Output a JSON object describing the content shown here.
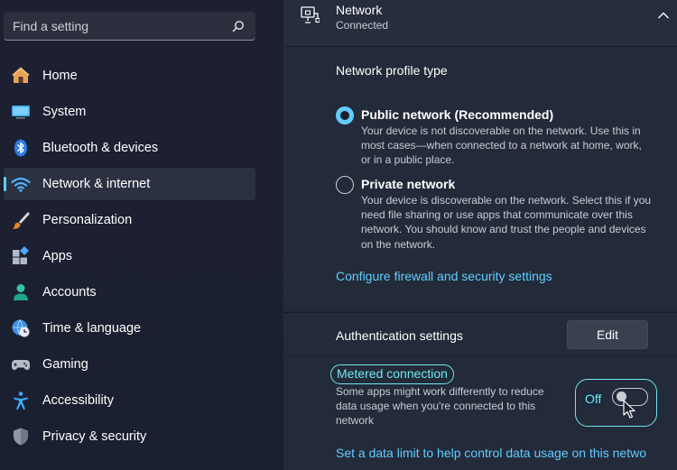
{
  "search": {
    "placeholder": "Find a setting"
  },
  "sidebar": {
    "items": [
      {
        "label": "Home",
        "icon": "home-icon",
        "active": false
      },
      {
        "label": "System",
        "icon": "monitor-icon",
        "active": false
      },
      {
        "label": "Bluetooth & devices",
        "icon": "bluetooth-icon",
        "active": false
      },
      {
        "label": "Network & internet",
        "icon": "wifi-icon",
        "active": true
      },
      {
        "label": "Personalization",
        "icon": "brush-icon",
        "active": false
      },
      {
        "label": "Apps",
        "icon": "apps-icon",
        "active": false
      },
      {
        "label": "Accounts",
        "icon": "person-icon",
        "active": false
      },
      {
        "label": "Time & language",
        "icon": "globe-clock-icon",
        "active": false
      },
      {
        "label": "Gaming",
        "icon": "gamepad-icon",
        "active": false
      },
      {
        "label": "Accessibility",
        "icon": "accessibility-icon",
        "active": false
      },
      {
        "label": "Privacy & security",
        "icon": "shield-icon",
        "active": false
      }
    ]
  },
  "header": {
    "title": "Network",
    "subtitle": "Connected"
  },
  "profile": {
    "title": "Network profile type",
    "options": [
      {
        "label": "Public network (Recommended)",
        "description": "Your device is not discoverable on the network. Use this in most cases—when connected to a network at home, work, or in a public place.",
        "selected": true
      },
      {
        "label": "Private network",
        "description": "Your device is discoverable on the network. Select this if you need file sharing or use apps that communicate over this network. You should know and trust the people and devices on the network.",
        "selected": false
      }
    ],
    "firewall_link": "Configure firewall and security settings"
  },
  "auth": {
    "label": "Authentication settings",
    "edit_label": "Edit"
  },
  "metered": {
    "title": "Metered connection",
    "description": "Some apps might work differently to reduce data usage when you're connected to this network",
    "state_label": "Off",
    "on": false,
    "data_limit_link": "Set a data limit to help control data usage on this netwo"
  },
  "colors": {
    "accent": "#60cdff",
    "highlight": "#6ee8ef"
  }
}
